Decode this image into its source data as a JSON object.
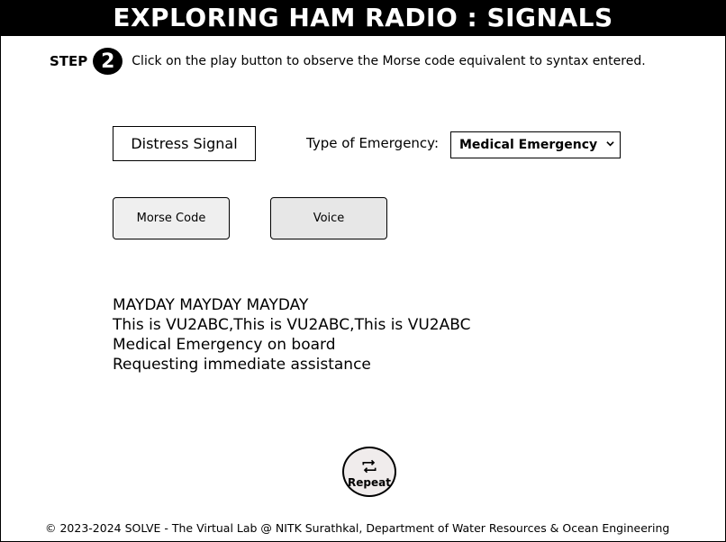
{
  "header": {
    "title": "EXPLORING HAM RADIO : SIGNALS"
  },
  "step": {
    "label": "STEP",
    "number": "2",
    "instruction": "Click on the play button to observe the Morse code equivalent to syntax entered."
  },
  "controls": {
    "distress_button": "Distress Signal",
    "emergency_label": "Type of Emergency:",
    "emergency_selected": "Medical Emergency",
    "morse_button": "Morse Code",
    "voice_button": "Voice"
  },
  "message": {
    "lines": [
      "MAYDAY MAYDAY MAYDAY",
      "This is VU2ABC,This is VU2ABC,This is VU2ABC",
      "Medical Emergency on board",
      "Requesting immediate assistance"
    ]
  },
  "repeat": {
    "label": "Repeat",
    "icon": "repeat-icon"
  },
  "footer": {
    "text": "© 2023-2024 SOLVE - The Virtual Lab @ NITK Surathkal, Department of Water Resources & Ocean Engineering"
  }
}
